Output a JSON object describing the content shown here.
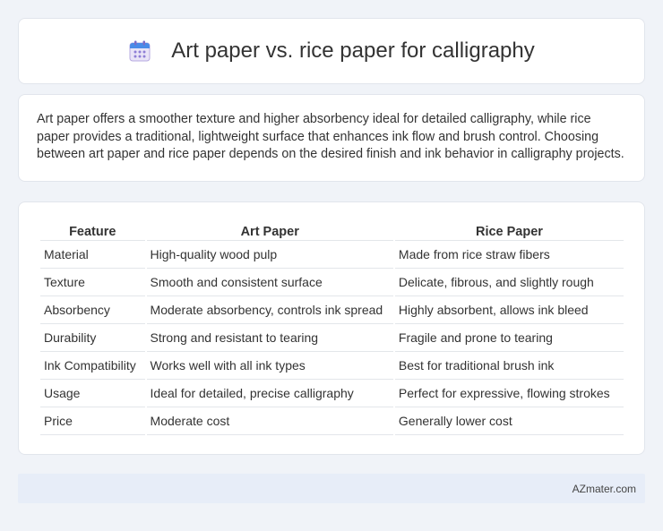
{
  "header": {
    "title": "Art paper vs. rice paper for calligraphy",
    "icon": "calendar-icon"
  },
  "description": "Art paper offers a smoother texture and higher absorbency ideal for detailed calligraphy, while rice paper provides a traditional, lightweight surface that enhances ink flow and brush control. Choosing between art paper and rice paper depends on the desired finish and ink behavior in calligraphy projects.",
  "table": {
    "headers": [
      "Feature",
      "Art Paper",
      "Rice Paper"
    ],
    "rows": [
      [
        "Material",
        "High-quality wood pulp",
        "Made from rice straw fibers"
      ],
      [
        "Texture",
        "Smooth and consistent surface",
        "Delicate, fibrous, and slightly rough"
      ],
      [
        "Absorbency",
        "Moderate absorbency, controls ink spread",
        "Highly absorbent, allows ink bleed"
      ],
      [
        "Durability",
        "Strong and resistant to tearing",
        "Fragile and prone to tearing"
      ],
      [
        "Ink Compatibility",
        "Works well with all ink types",
        "Best for traditional brush ink"
      ],
      [
        "Usage",
        "Ideal for detailed, precise calligraphy",
        "Perfect for expressive, flowing strokes"
      ],
      [
        "Price",
        "Moderate cost",
        "Generally lower cost"
      ]
    ]
  },
  "footer": {
    "source": "AZmater.com"
  },
  "colors": {
    "background": "#f0f3f8",
    "card": "#ffffff",
    "footer": "#e7edf8"
  }
}
